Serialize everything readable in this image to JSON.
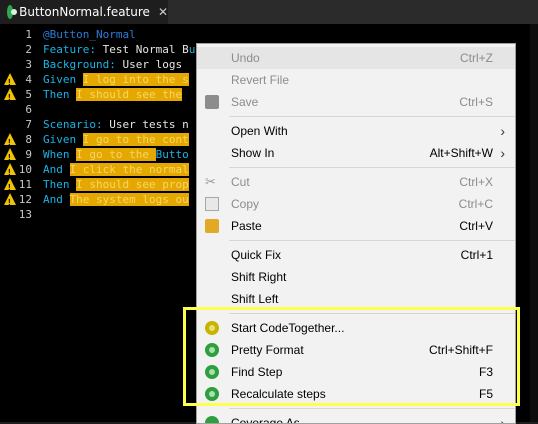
{
  "tab": {
    "title": "ButtonNormal.feature",
    "close": "✕",
    "icon": "cucumber-icon"
  },
  "code_lines": [
    {
      "n": "1",
      "warn": false,
      "parts": [
        {
          "t": "@Button_Normal",
          "c": "tagc"
        }
      ]
    },
    {
      "n": "2",
      "warn": false,
      "parts": [
        {
          "t": "Feature: ",
          "c": "kw"
        },
        {
          "t": "Test Normal B",
          "c": "txt"
        },
        {
          "t": "ut",
          "c": "kw"
        }
      ]
    },
    {
      "n": "3",
      "warn": false,
      "parts": [
        {
          "t": "Background: ",
          "c": "kw"
        },
        {
          "t": "User logs",
          "c": "txt"
        }
      ]
    },
    {
      "n": "4",
      "warn": true,
      "parts": [
        {
          "t": "Given ",
          "c": "kw"
        },
        {
          "t": "I log into the s",
          "c": "hl"
        }
      ]
    },
    {
      "n": "5",
      "warn": true,
      "parts": [
        {
          "t": "Then ",
          "c": "kw"
        },
        {
          "t": "I should see the",
          "c": "hl"
        }
      ]
    },
    {
      "n": "6",
      "warn": false,
      "parts": []
    },
    {
      "n": "7",
      "warn": false,
      "parts": [
        {
          "t": "Scenario: ",
          "c": "kw"
        },
        {
          "t": "User tests n",
          "c": "txt"
        }
      ]
    },
    {
      "n": "8",
      "warn": true,
      "parts": [
        {
          "t": "Given ",
          "c": "kw"
        },
        {
          "t": "I go to the cont",
          "c": "hl"
        }
      ]
    },
    {
      "n": "9",
      "warn": true,
      "parts": [
        {
          "t": "When ",
          "c": "kw"
        },
        {
          "t": "I go to the ",
          "c": "hl"
        },
        {
          "t": "Butto",
          "c": "kw"
        }
      ]
    },
    {
      "n": "10",
      "warn": true,
      "parts": [
        {
          "t": "And ",
          "c": "kw"
        },
        {
          "t": "I click the normal",
          "c": "hl"
        }
      ]
    },
    {
      "n": "11",
      "warn": true,
      "parts": [
        {
          "t": "Then ",
          "c": "kw"
        },
        {
          "t": "I should see prop",
          "c": "hl"
        }
      ]
    },
    {
      "n": "12",
      "warn": true,
      "parts": [
        {
          "t": "And ",
          "c": "kw"
        },
        {
          "t": "The system logs ou",
          "c": "hl"
        }
      ]
    },
    {
      "n": "13",
      "warn": false,
      "parts": []
    }
  ],
  "menu": {
    "items": [
      {
        "label": "Undo",
        "shortcut": "Ctrl+Z",
        "disabled": true,
        "hover": true,
        "icon": "",
        "arrow": false
      },
      {
        "label": "Revert File",
        "shortcut": "",
        "disabled": true,
        "icon": "",
        "arrow": false
      },
      {
        "label": "Save",
        "shortcut": "Ctrl+S",
        "disabled": true,
        "icon": "save-icon",
        "arrow": false
      },
      {
        "sep": true
      },
      {
        "label": "Open With",
        "shortcut": "",
        "disabled": false,
        "icon": "",
        "arrow": true
      },
      {
        "label": "Show In",
        "shortcut": "Alt+Shift+W",
        "disabled": false,
        "icon": "",
        "arrow": true
      },
      {
        "sep": true
      },
      {
        "label": "Cut",
        "shortcut": "Ctrl+X",
        "disabled": true,
        "icon": "cut-icon",
        "arrow": false
      },
      {
        "label": "Copy",
        "shortcut": "Ctrl+C",
        "disabled": true,
        "icon": "copy-icon",
        "arrow": false
      },
      {
        "label": "Paste",
        "shortcut": "Ctrl+V",
        "disabled": false,
        "icon": "paste-icon",
        "arrow": false
      },
      {
        "sep": true
      },
      {
        "label": "Quick Fix",
        "shortcut": "Ctrl+1",
        "disabled": false,
        "icon": "",
        "arrow": false
      },
      {
        "label": "Shift Right",
        "shortcut": "",
        "disabled": false,
        "icon": "",
        "arrow": false
      },
      {
        "label": "Shift Left",
        "shortcut": "",
        "disabled": false,
        "icon": "",
        "arrow": false
      },
      {
        "sep": true
      },
      {
        "label": "Start CodeTogether...",
        "shortcut": "",
        "disabled": false,
        "icon": "codetogether-icon",
        "arrow": false
      },
      {
        "label": "Pretty Format",
        "shortcut": "Ctrl+Shift+F",
        "disabled": false,
        "icon": "cucumber-icon",
        "arrow": false
      },
      {
        "label": "Find Step",
        "shortcut": "F3",
        "disabled": false,
        "icon": "cucumber-icon",
        "arrow": false
      },
      {
        "label": "Recalculate steps",
        "shortcut": "F5",
        "disabled": false,
        "icon": "cucumber-icon",
        "arrow": false
      },
      {
        "sep": true
      },
      {
        "label": "Coverage As",
        "shortcut": "",
        "disabled": false,
        "icon": "coverage-icon",
        "arrow": true
      }
    ]
  },
  "colors": {
    "highlight_box": "#ffff4d",
    "step_highlight": "#e5a800",
    "keyword": "#19b3e6"
  }
}
